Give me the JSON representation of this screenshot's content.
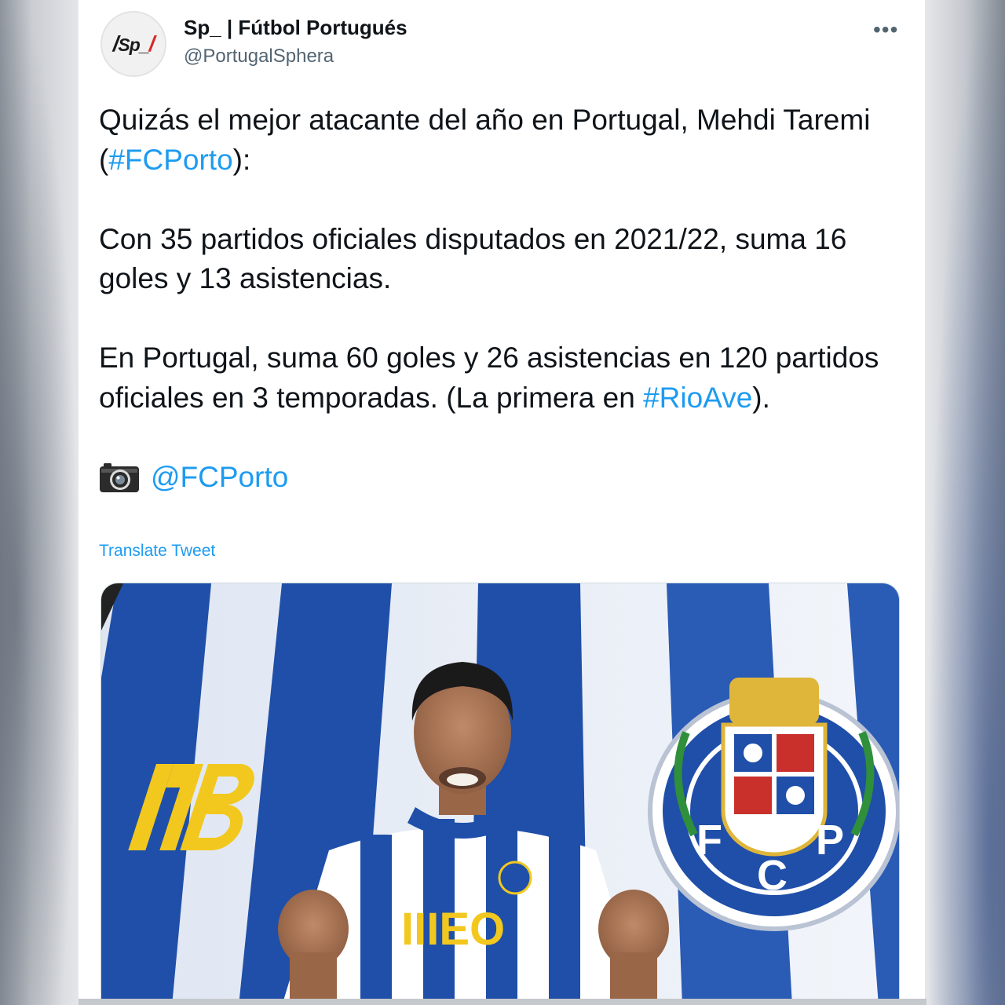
{
  "author": {
    "avatar_text": "Sp_",
    "display_name": "Sp_ | Fútbol Portugués",
    "handle": "@PortugalSphera"
  },
  "menu": {
    "more_label": "•••"
  },
  "tweet": {
    "line1_pre": "Quizás el mejor atacante del año en Portugal, Mehdi Taremi (",
    "line1_tag": "#FCPorto",
    "line1_post": "):",
    "paragraph2": "Con 35 partidos oficiales disputados en 2021/22, suma 16 goles y 13 asistencias.",
    "line3_pre": "En Portugal, suma 60 goles y 26 asistencias en 120 partidos oficiales en 3 temporadas. (La primera en ",
    "line3_tag": "#RioAve",
    "line3_post": ").",
    "photo_credit": "@FCPorto",
    "camera_icon": "camera-icon"
  },
  "translate_label": "Translate Tweet",
  "media": {
    "shirt_brand": "IIIEO",
    "crest_letters": [
      "F",
      "C",
      "P"
    ],
    "colors": {
      "blue": "#1f4fa8",
      "yellow": "#f2c81e",
      "link": "#1d9bf0"
    }
  }
}
